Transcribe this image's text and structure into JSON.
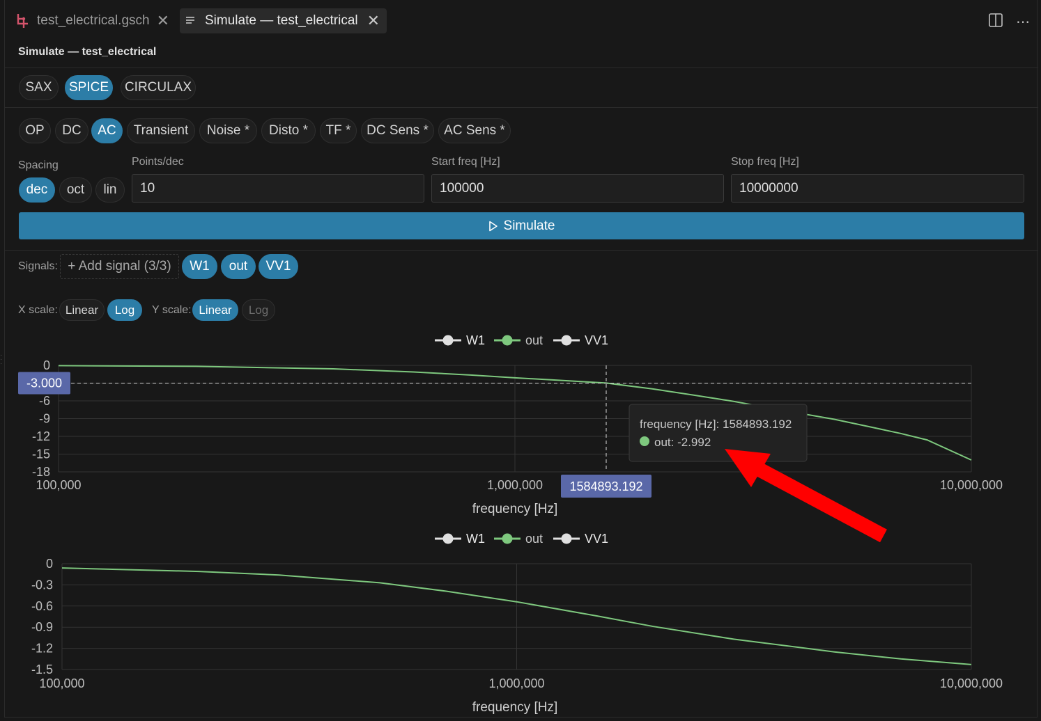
{
  "tabs": [
    {
      "label": "test_electrical.gsch",
      "icon": "schematic-icon",
      "active": false
    },
    {
      "label": "Simulate — test_electrical",
      "icon": "list-icon",
      "active": true
    }
  ],
  "header": {
    "title": "Simulate — test_electrical"
  },
  "engines": [
    {
      "label": "SAX",
      "active": false
    },
    {
      "label": "SPICE",
      "active": true
    },
    {
      "label": "CIRCULAX",
      "active": false
    }
  ],
  "analyses": [
    {
      "label": "OP",
      "active": false
    },
    {
      "label": "DC",
      "active": false
    },
    {
      "label": "AC",
      "active": true
    },
    {
      "label": "Transient",
      "active": false
    },
    {
      "label": "Noise *",
      "active": false
    },
    {
      "label": "Disto *",
      "active": false
    },
    {
      "label": "TF *",
      "active": false
    },
    {
      "label": "DC Sens *",
      "active": false
    },
    {
      "label": "AC Sens *",
      "active": false
    }
  ],
  "params": {
    "spacing_label": "Spacing",
    "spacing_options": [
      {
        "label": "dec",
        "active": true
      },
      {
        "label": "oct",
        "active": false
      },
      {
        "label": "lin",
        "active": false
      }
    ],
    "points_label": "Points/dec",
    "points_value": "10",
    "start_label": "Start freq [Hz]",
    "start_value": "100000",
    "stop_label": "Stop freq [Hz]",
    "stop_value": "10000000"
  },
  "simulate_label": "Simulate",
  "signals": {
    "label": "Signals:",
    "add_label": "+ Add signal (3/3)",
    "chips": [
      "W1",
      "out",
      "VV1"
    ]
  },
  "scales": {
    "x_label": "X scale:",
    "x_options": [
      {
        "label": "Linear",
        "active": false
      },
      {
        "label": "Log",
        "active": true
      }
    ],
    "y_label": "Y scale:",
    "y_options": [
      {
        "label": "Linear",
        "active": true
      },
      {
        "label": "Log",
        "active": false,
        "disabled": true
      }
    ]
  },
  "colors": {
    "accent": "#2c7da7",
    "out_series": "#7ec87e",
    "other_series": "#e0e0e0",
    "crosshair_badge": "#5a68a8",
    "annotation_arrow": "#ff0000"
  },
  "chart_data": [
    {
      "type": "line",
      "xlabel": "frequency [Hz]",
      "x_scale": "log",
      "xlim": [
        100000,
        10000000
      ],
      "x_ticks": [
        "100,000",
        "1,000,000",
        "10,000,000"
      ],
      "x_tick_values": [
        100000,
        1000000,
        10000000
      ],
      "ylim": [
        -18,
        0
      ],
      "y_ticks": [
        "0",
        "-3",
        "-6",
        "-9",
        "-12",
        "-15",
        "-18"
      ],
      "y_tick_values": [
        0,
        -3,
        -6,
        -9,
        -12,
        -15,
        -18
      ],
      "legend": [
        "W1",
        "out",
        "VV1"
      ],
      "legend_position": "top-center",
      "series": [
        {
          "name": "out",
          "x": [
            100000,
            200000,
            400000,
            600000,
            800000,
            1000000,
            1200000,
            1584893,
            2000000,
            2500000,
            3000000,
            4000000,
            5000000,
            6000000,
            7000000,
            8000000,
            10000000
          ],
          "y": [
            -0.05,
            -0.17,
            -0.59,
            -1.12,
            -1.63,
            -2.1,
            -2.45,
            -2.992,
            -3.98,
            -5.1,
            -6.06,
            -7.8,
            -9.1,
            -10.4,
            -11.5,
            -12.6,
            -16.0
          ]
        }
      ],
      "crosshair": {
        "x_label": "1584893.192",
        "y_label": "-3.000",
        "x": 1584893.192,
        "y": -3.0
      },
      "tooltip": {
        "title": "frequency [Hz]: 1584893.192",
        "entry": "out: -2.992"
      }
    },
    {
      "type": "line",
      "xlabel": "frequency [Hz]",
      "x_scale": "log",
      "xlim": [
        100000,
        10000000
      ],
      "x_ticks": [
        "100,000",
        "1,000,000",
        "10,000,000"
      ],
      "x_tick_values": [
        100000,
        1000000,
        10000000
      ],
      "ylim": [
        -1.5,
        0
      ],
      "y_ticks": [
        "0",
        "-0.3",
        "-0.6",
        "-0.9",
        "-1.2",
        "-1.5"
      ],
      "y_tick_values": [
        0,
        -0.3,
        -0.6,
        -0.9,
        -1.2,
        -1.5
      ],
      "legend": [
        "W1",
        "out",
        "VV1"
      ],
      "legend_position": "top-center",
      "series": [
        {
          "name": "out",
          "x": [
            100000,
            200000,
            300000,
            500000,
            700000,
            1000000,
            1500000,
            2000000,
            3000000,
            5000000,
            7000000,
            10000000
          ],
          "y": [
            -0.06,
            -0.11,
            -0.16,
            -0.27,
            -0.39,
            -0.54,
            -0.74,
            -0.89,
            -1.07,
            -1.25,
            -1.35,
            -1.43
          ]
        }
      ]
    }
  ]
}
